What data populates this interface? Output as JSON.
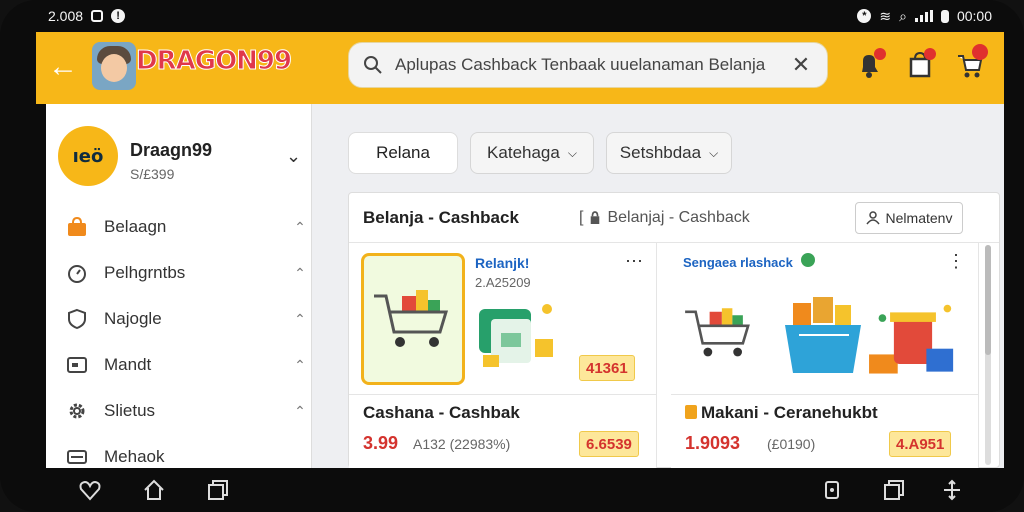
{
  "status_bar": {
    "left_text": "2.008",
    "time": "00:00"
  },
  "app": {
    "logo_text": "DRAGON99",
    "search": {
      "query": "Aplupas Cashback  Tenbaak uuelanaman Belanja"
    },
    "header_icons": [
      "bell-icon",
      "bag-icon",
      "cart-icon"
    ]
  },
  "sidebar": {
    "profile": {
      "name": "Draagn99",
      "id": "S/£399",
      "avatar_text": "ıeö"
    },
    "items": [
      {
        "label": "Belaagn",
        "icon": "bag-icon"
      },
      {
        "label": "Pelhgrntbs",
        "icon": "speed-icon"
      },
      {
        "label": "Najogle",
        "icon": "shield-icon"
      },
      {
        "label": "Mandt",
        "icon": "wallet-icon"
      },
      {
        "label": "Slietus",
        "icon": "gear-icon"
      },
      {
        "label": "Mehaok",
        "icon": "card-icon"
      }
    ]
  },
  "main": {
    "tabs": [
      {
        "label": "Relana",
        "active": true
      },
      {
        "label": "Katehaga",
        "dropdown": true
      },
      {
        "label": "Setshbdaa",
        "dropdown": true
      }
    ],
    "panel": {
      "title": "Belanja - Cashback",
      "subtitle": "Belanjaj  -  Cashback",
      "subtitle_prefix": "[",
      "button_label": "Nelmatenv"
    },
    "cards": [
      {
        "tag": "Relanjk!",
        "tag_sub": "2.A25209",
        "img_pill": "41361",
        "name": "Cashana - Cashbak",
        "price": "3.99",
        "old_price": "A132 (22983%)",
        "pill": "6.6539"
      },
      {
        "tag": "Sengaea rlashack",
        "img_pill": "",
        "name": "Makani - Ceranehukbt",
        "price": "1.9093",
        "old_price": "(£0190)",
        "pill": "4.A951"
      }
    ]
  },
  "colors": {
    "accent": "#f7b718",
    "price": "#d4332e",
    "pill_bg": "#fde79a"
  }
}
